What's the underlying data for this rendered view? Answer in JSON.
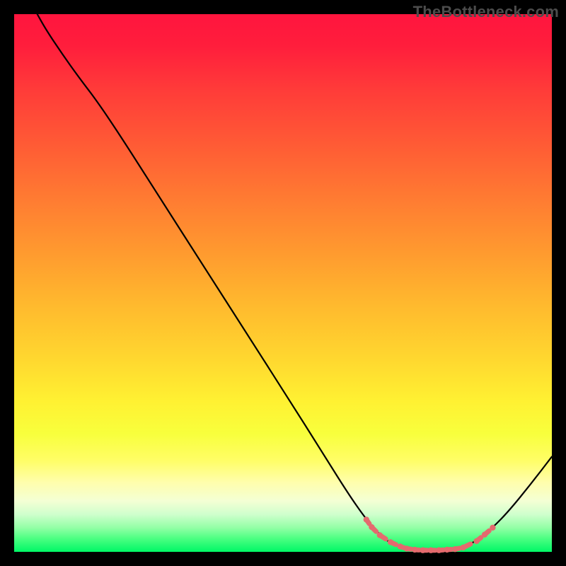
{
  "watermark": "TheBottleneck.com",
  "chart_data": {
    "type": "line",
    "title": "",
    "xlabel": "",
    "ylabel": "",
    "xlim": [
      0,
      100
    ],
    "ylim": [
      0,
      100
    ],
    "series": [
      {
        "name": "black-curve",
        "stroke": "#000000",
        "points": [
          {
            "x": 4.3,
            "y": 100.0
          },
          {
            "x": 6.0,
            "y": 97.0
          },
          {
            "x": 9.0,
            "y": 92.5
          },
          {
            "x": 12.0,
            "y": 88.3
          },
          {
            "x": 15.5,
            "y": 83.7
          },
          {
            "x": 20.0,
            "y": 77.0
          },
          {
            "x": 27.0,
            "y": 66.0
          },
          {
            "x": 35.0,
            "y": 53.5
          },
          {
            "x": 43.0,
            "y": 41.0
          },
          {
            "x": 51.0,
            "y": 28.5
          },
          {
            "x": 57.0,
            "y": 19.0
          },
          {
            "x": 62.0,
            "y": 11.0
          },
          {
            "x": 65.5,
            "y": 6.0
          },
          {
            "x": 68.2,
            "y": 3.0
          },
          {
            "x": 70.0,
            "y": 1.6
          },
          {
            "x": 73.0,
            "y": 0.6
          },
          {
            "x": 76.0,
            "y": 0.3
          },
          {
            "x": 80.0,
            "y": 0.3
          },
          {
            "x": 83.0,
            "y": 0.7
          },
          {
            "x": 86.0,
            "y": 2.0
          },
          {
            "x": 89.0,
            "y": 4.5
          },
          {
            "x": 92.0,
            "y": 7.6
          },
          {
            "x": 96.0,
            "y": 12.5
          },
          {
            "x": 100.0,
            "y": 17.7
          }
        ]
      },
      {
        "name": "red-markers",
        "stroke": "#e46a6e",
        "marker": "circle",
        "points": [
          {
            "x": 65.5,
            "y": 6.0
          },
          {
            "x": 66.5,
            "y": 4.6
          },
          {
            "x": 68.0,
            "y": 3.1
          },
          {
            "x": 70.0,
            "y": 1.8
          },
          {
            "x": 71.8,
            "y": 1.0
          },
          {
            "x": 73.0,
            "y": 0.6
          },
          {
            "x": 74.5,
            "y": 0.4
          },
          {
            "x": 76.0,
            "y": 0.3
          },
          {
            "x": 77.5,
            "y": 0.3
          },
          {
            "x": 79.0,
            "y": 0.3
          },
          {
            "x": 80.5,
            "y": 0.4
          },
          {
            "x": 82.0,
            "y": 0.5
          },
          {
            "x": 83.5,
            "y": 0.8
          },
          {
            "x": 86.0,
            "y": 2.0
          },
          {
            "x": 87.5,
            "y": 3.2
          },
          {
            "x": 89.0,
            "y": 4.5
          }
        ]
      }
    ],
    "gradient_stops": [
      {
        "pos": 0.0,
        "color": "#ff153e"
      },
      {
        "pos": 0.5,
        "color": "#ffb92e"
      },
      {
        "pos": 0.78,
        "color": "#f8ff3c"
      },
      {
        "pos": 0.93,
        "color": "#d0ffcd"
      },
      {
        "pos": 1.0,
        "color": "#00f766"
      }
    ]
  }
}
